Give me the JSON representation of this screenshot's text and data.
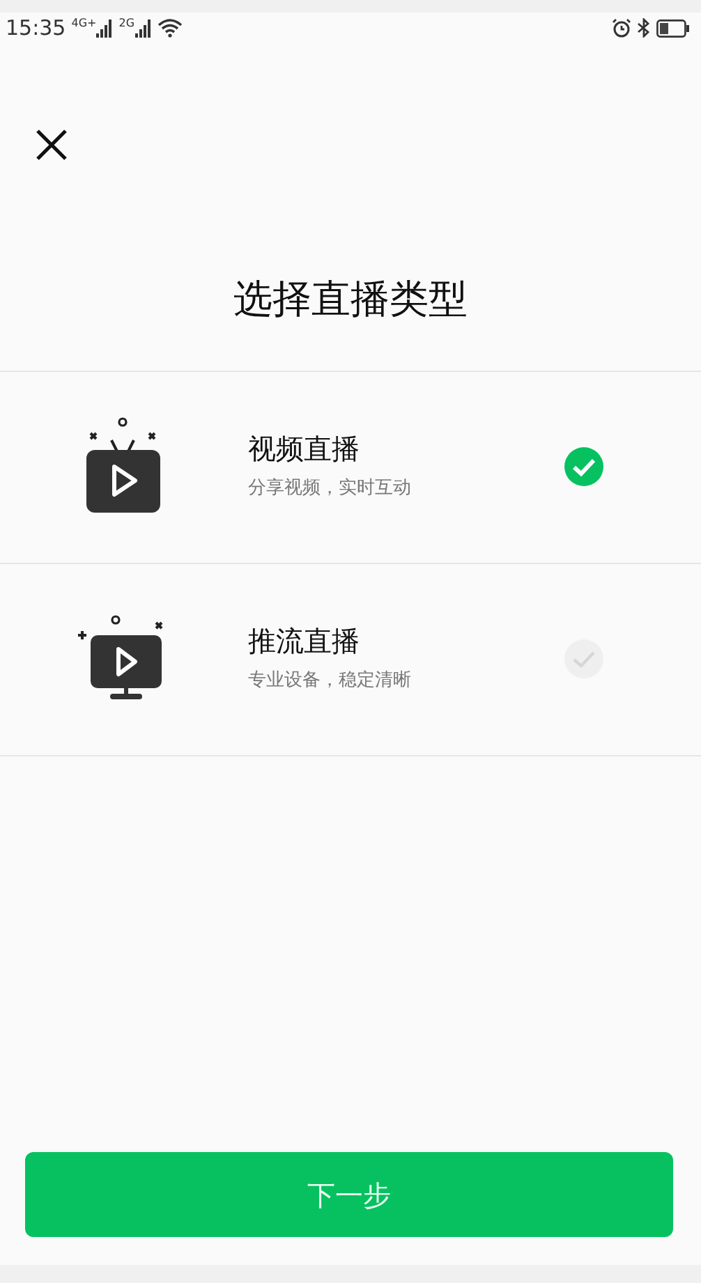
{
  "status_bar": {
    "time": "15:35",
    "networks": [
      "4G+",
      "2G"
    ]
  },
  "title": "选择直播类型",
  "options": [
    {
      "kind": "tv",
      "name": "视频直播",
      "description": "分享视频，实时互动",
      "selected": true
    },
    {
      "kind": "monitor",
      "name": "推流直播",
      "description": "专业设备，稳定清晰",
      "selected": false
    }
  ],
  "next_button": "下一步"
}
